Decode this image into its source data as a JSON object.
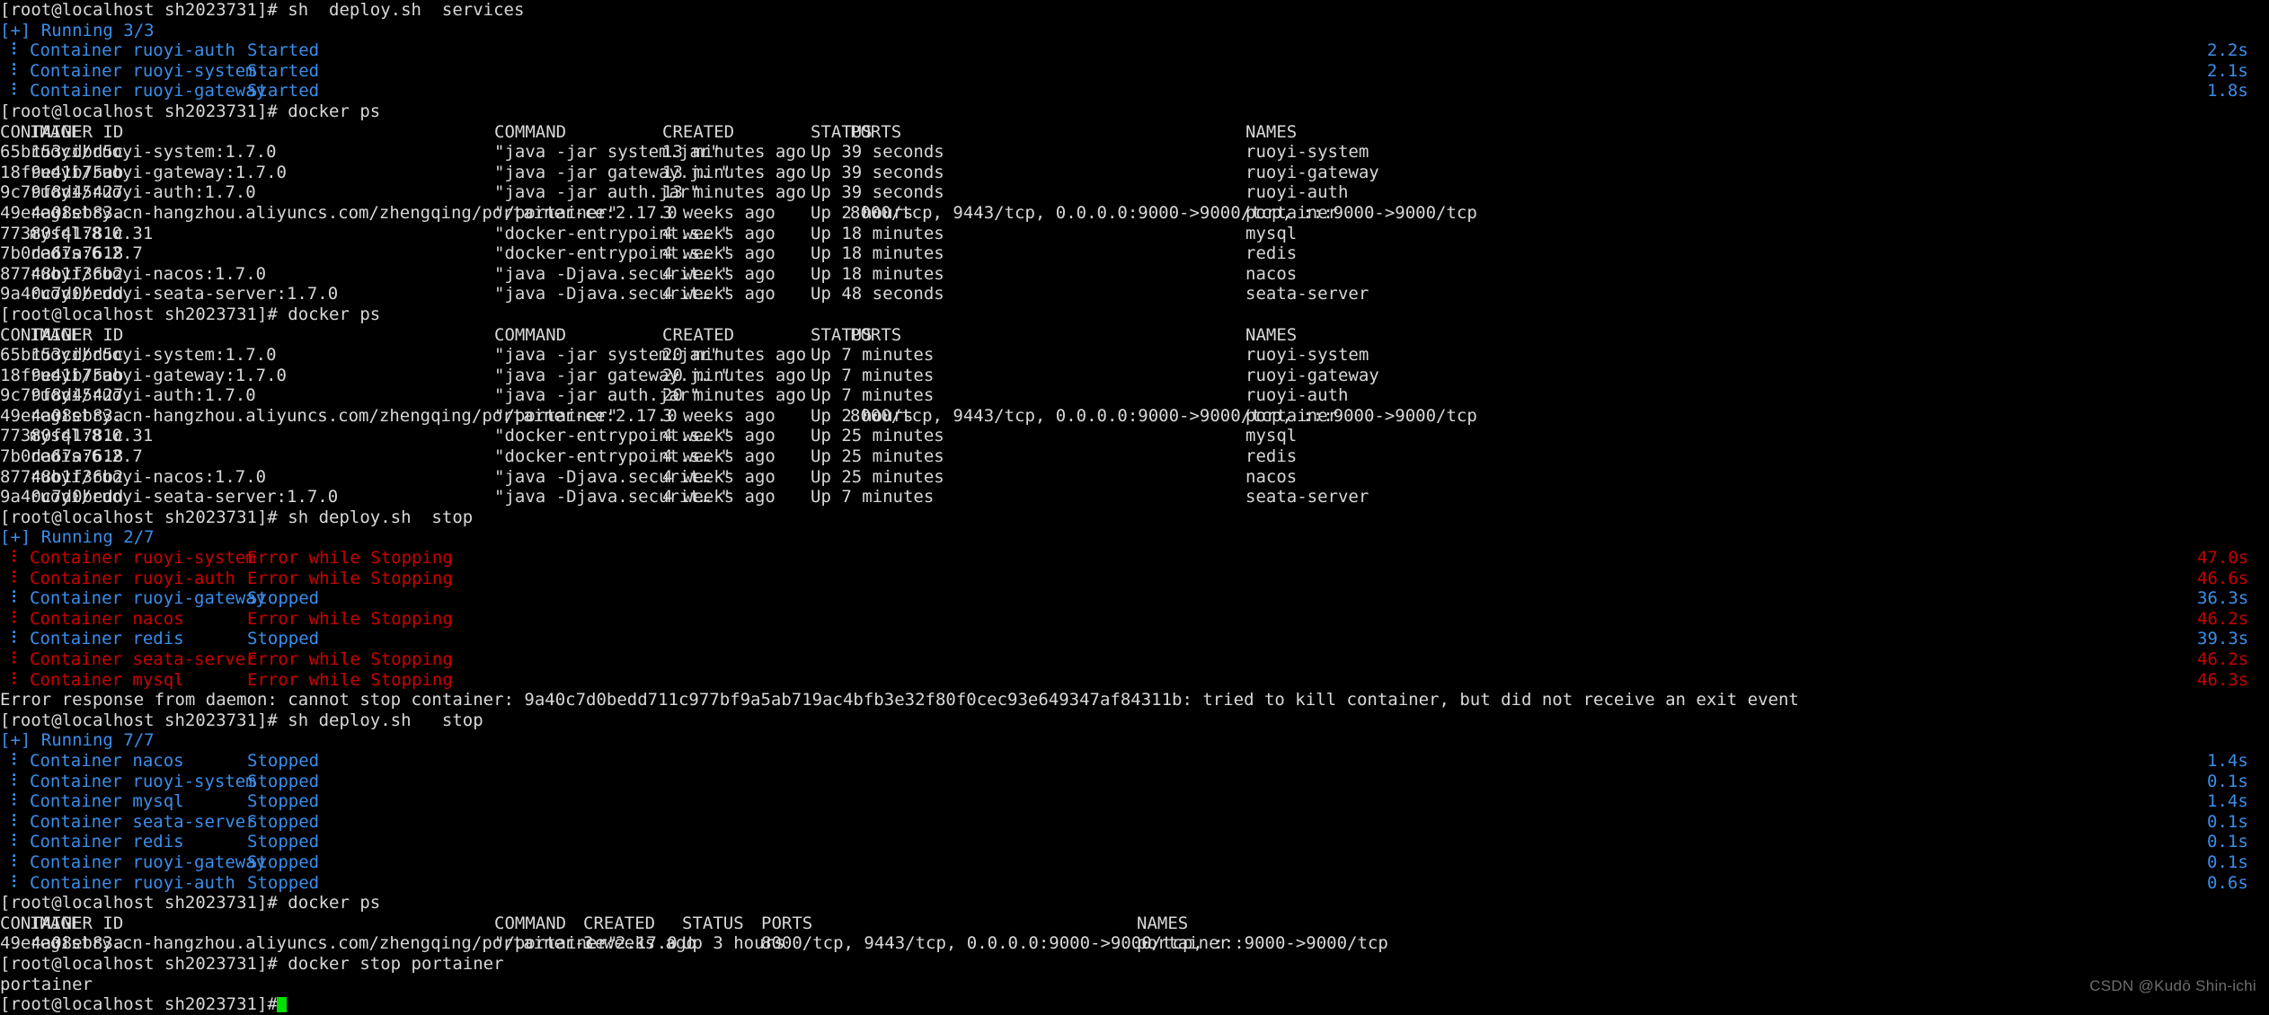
{
  "terminal": {
    "prompt": "[root@localhost sh2023731]# ",
    "colors": {
      "background": "#000000",
      "foreground": "#d8d8d8",
      "blue": "#2e7fd4",
      "bright_blue": "#3b8eea",
      "red": "#cc0000",
      "green": "#00d000",
      "watermark": "#6e6e6e"
    },
    "cursor_color": "#00e000",
    "watermark": "CSDN @Kudō Shin-ichi"
  },
  "commands": {
    "deploy_services": "sh  deploy.sh  services",
    "docker_ps": "docker ps",
    "deploy_stop": "sh deploy.sh  stop",
    "deploy_stop2": "sh deploy.sh   stop",
    "docker_stop_portainer": "docker stop portainer"
  },
  "compose_blocks": [
    {
      "header": "[+] Running 3/3",
      "rows": [
        {
          "bullet": "⠇",
          "label": "Container ruoyi-auth",
          "status": "Started",
          "time": "2.2s",
          "color": "blue"
        },
        {
          "bullet": "⠇",
          "label": "Container ruoyi-system",
          "status": "Started",
          "time": "2.1s",
          "color": "blue"
        },
        {
          "bullet": "⠇",
          "label": "Container ruoyi-gateway",
          "status": "Started",
          "time": "1.8s",
          "color": "blue"
        }
      ]
    },
    {
      "header": "[+] Running 2/7",
      "rows": [
        {
          "bullet": "⠇",
          "label": "Container ruoyi-system",
          "status": "Error while Stopping",
          "time": "47.0s",
          "color": "red"
        },
        {
          "bullet": "⠇",
          "label": "Container ruoyi-auth",
          "status": "Error while Stopping",
          "time": "46.6s",
          "color": "red"
        },
        {
          "bullet": "⠇",
          "label": "Container ruoyi-gateway",
          "status": "Stopped",
          "time": "36.3s",
          "color": "blue"
        },
        {
          "bullet": "⠇",
          "label": "Container nacos",
          "status": "Error while Stopping",
          "time": "46.2s",
          "color": "red"
        },
        {
          "bullet": "⠇",
          "label": "Container redis",
          "status": "Stopped",
          "time": "39.3s",
          "color": "blue"
        },
        {
          "bullet": "⠇",
          "label": "Container seata-server",
          "status": "Error while Stopping",
          "time": "46.2s",
          "color": "red"
        },
        {
          "bullet": "⠇",
          "label": "Container mysql",
          "status": "Error while Stopping",
          "time": "46.3s",
          "color": "red"
        }
      ]
    },
    {
      "header": "[+] Running 7/7",
      "rows": [
        {
          "bullet": "⠇",
          "label": "Container nacos",
          "status": "Stopped",
          "time": "1.4s",
          "color": "blue"
        },
        {
          "bullet": "⠇",
          "label": "Container ruoyi-system",
          "status": "Stopped",
          "time": "0.1s",
          "color": "blue"
        },
        {
          "bullet": "⠇",
          "label": "Container mysql",
          "status": "Stopped",
          "time": "1.4s",
          "color": "blue"
        },
        {
          "bullet": "⠇",
          "label": "Container seata-server",
          "status": "Stopped",
          "time": "0.1s",
          "color": "blue"
        },
        {
          "bullet": "⠇",
          "label": "Container redis",
          "status": "Stopped",
          "time": "0.1s",
          "color": "blue"
        },
        {
          "bullet": "⠇",
          "label": "Container ruoyi-gateway",
          "status": "Stopped",
          "time": "0.1s",
          "color": "blue"
        },
        {
          "bullet": "⠇",
          "label": "Container ruoyi-auth",
          "status": "Stopped",
          "time": "0.6s",
          "color": "blue"
        }
      ]
    }
  ],
  "docker_ps_tables": [
    {
      "headers": [
        "CONTAINER ID",
        "IMAGE",
        "COMMAND",
        "CREATED",
        "STATUS",
        "PORTS",
        "NAMES"
      ],
      "rows": [
        {
          "id": "65b153cdbd5c",
          "image": "ruoyi/ruoyi-system:1.7.0",
          "command": "\"java -jar system.jar\"",
          "created": "13 minutes ago",
          "status": "Up 39 seconds",
          "ports": "",
          "names": "ruoyi-system"
        },
        {
          "id": "18f9e41b75ab",
          "image": "ruoyi/ruoyi-gateway:1.7.0",
          "command": "\"java -jar gateway.j… \"",
          "created": "13 minutes ago",
          "status": "Up 39 seconds",
          "ports": "",
          "names": "ruoyi-gateway"
        },
        {
          "id": "9c79f8d45427",
          "image": "ruoyi/ruoyi-auth:1.7.0",
          "command": "\"java -jar auth.jar\"",
          "created": "13 minutes ago",
          "status": "Up 39 seconds",
          "ports": "",
          "names": "ruoyi-auth"
        },
        {
          "id": "49e4a08eb83a",
          "image": "registry.cn-hangzhou.aliyuncs.com/zhengqing/portainer-ce:2.17.0",
          "command": "\"/portainer\"",
          "created": "3 weeks ago",
          "status": "Up 2 hours",
          "ports": "8000/tcp, 9443/tcp, 0.0.0.0:9000->9000/tcp, :::9000->9000/tcp",
          "names": "portainer"
        },
        {
          "id": "77380f41781c",
          "image": "mysql:8.0.31",
          "command": "\"docker-entrypoint.s… \"",
          "created": "4 weeks ago",
          "status": "Up 18 minutes",
          "ports": "",
          "names": "mysql"
        },
        {
          "id": "7b0da67a7618",
          "image": "redis:6.2.7",
          "command": "\"docker-entrypoint.s… \"",
          "created": "4 weeks ago",
          "status": "Up 18 minutes",
          "ports": "",
          "names": "redis"
        },
        {
          "id": "87748b1f36b2",
          "image": "ruoyi/ruoyi-nacos:1.7.0",
          "command": "\"java -Djava.securit… \"",
          "created": "4 weeks ago",
          "status": "Up 18 minutes",
          "ports": "",
          "names": "nacos"
        },
        {
          "id": "9a40c7d0bedd",
          "image": "ruoyi/ruoyi-seata-server:1.7.0",
          "command": "\"java -Djava.securit… \"",
          "created": "4 weeks ago",
          "status": "Up 48 seconds",
          "ports": "",
          "names": "seata-server"
        }
      ]
    },
    {
      "headers": [
        "CONTAINER ID",
        "IMAGE",
        "COMMAND",
        "CREATED",
        "STATUS",
        "PORTS",
        "NAMES"
      ],
      "rows": [
        {
          "id": "65b153cdbd5c",
          "image": "ruoyi/ruoyi-system:1.7.0",
          "command": "\"java -jar system.jar\"",
          "created": "20 minutes ago",
          "status": "Up 7 minutes",
          "ports": "",
          "names": "ruoyi-system"
        },
        {
          "id": "18f9e41b75ab",
          "image": "ruoyi/ruoyi-gateway:1.7.0",
          "command": "\"java -jar gateway.j… \"",
          "created": "20 minutes ago",
          "status": "Up 7 minutes",
          "ports": "",
          "names": "ruoyi-gateway"
        },
        {
          "id": "9c79f8d45427",
          "image": "ruoyi/ruoyi-auth:1.7.0",
          "command": "\"java -jar auth.jar\"",
          "created": "20 minutes ago",
          "status": "Up 7 minutes",
          "ports": "",
          "names": "ruoyi-auth"
        },
        {
          "id": "49e4a08eb83a",
          "image": "registry.cn-hangzhou.aliyuncs.com/zhengqing/portainer-ce:2.17.0",
          "command": "\"/portainer\"",
          "created": "3 weeks ago",
          "status": "Up 2 hours",
          "ports": "8000/tcp, 9443/tcp, 0.0.0.0:9000->9000/tcp, :::9000->9000/tcp",
          "names": "portainer"
        },
        {
          "id": "77380f41781c",
          "image": "mysql:8.0.31",
          "command": "\"docker-entrypoint.s… \"",
          "created": "4 weeks ago",
          "status": "Up 25 minutes",
          "ports": "",
          "names": "mysql"
        },
        {
          "id": "7b0da67a7618",
          "image": "redis:6.2.7",
          "command": "\"docker-entrypoint.s… \"",
          "created": "4 weeks ago",
          "status": "Up 25 minutes",
          "ports": "",
          "names": "redis"
        },
        {
          "id": "87748b1f36b2",
          "image": "ruoyi/ruoyi-nacos:1.7.0",
          "command": "\"java -Djava.securit… \"",
          "created": "4 weeks ago",
          "status": "Up 25 minutes",
          "ports": "",
          "names": "nacos"
        },
        {
          "id": "9a40c7d0bedd",
          "image": "ruoyi/ruoyi-seata-server:1.7.0",
          "command": "\"java -Djava.securit… \"",
          "created": "4 weeks ago",
          "status": "Up 7 minutes",
          "ports": "",
          "names": "seata-server"
        }
      ]
    },
    {
      "headers": [
        "CONTAINER ID",
        "IMAGE",
        "COMMAND",
        "CREATED",
        "STATUS",
        "PORTS",
        "NAMES"
      ],
      "rows": [
        {
          "id": "49e4a08eb83a",
          "image": "registry.cn-hangzhou.aliyuncs.com/zhengqing/portainer-ce:2.17.0",
          "command": "\"/portainer\"",
          "created": "3 weeks ago",
          "status": "Up 3 hours",
          "ports": "8000/tcp, 9443/tcp, 0.0.0.0:9000->9000/tcp, :::9000->9000/tcp",
          "names": "portainer"
        }
      ]
    }
  ],
  "error_message": "Error response from daemon: cannot stop container: 9a40c7d0bedd711c977bf9a5ab719ac4bfb3e32f80f0cec93e649347af84311b: tried to kill container, but did not receive an exit event",
  "stop_output": "portainer"
}
